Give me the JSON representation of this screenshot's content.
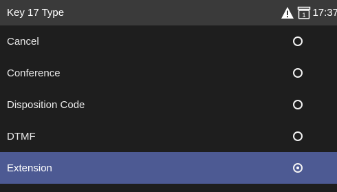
{
  "header": {
    "title": "Key 17 Type",
    "time": "17:37",
    "warning_icon": "warning-triangle-icon",
    "line_icon": "line-1-icon",
    "line_number": "1"
  },
  "options": [
    {
      "label": "Cancel",
      "selected": false
    },
    {
      "label": "Conference",
      "selected": false
    },
    {
      "label": "Disposition Code",
      "selected": false
    },
    {
      "label": "DTMF",
      "selected": false
    },
    {
      "label": "Extension",
      "selected": true
    }
  ],
  "colors": {
    "background": "#1e1e1e",
    "header": "#3a3a3a",
    "selected_row": "#4d5a93",
    "text": "#ececec"
  }
}
